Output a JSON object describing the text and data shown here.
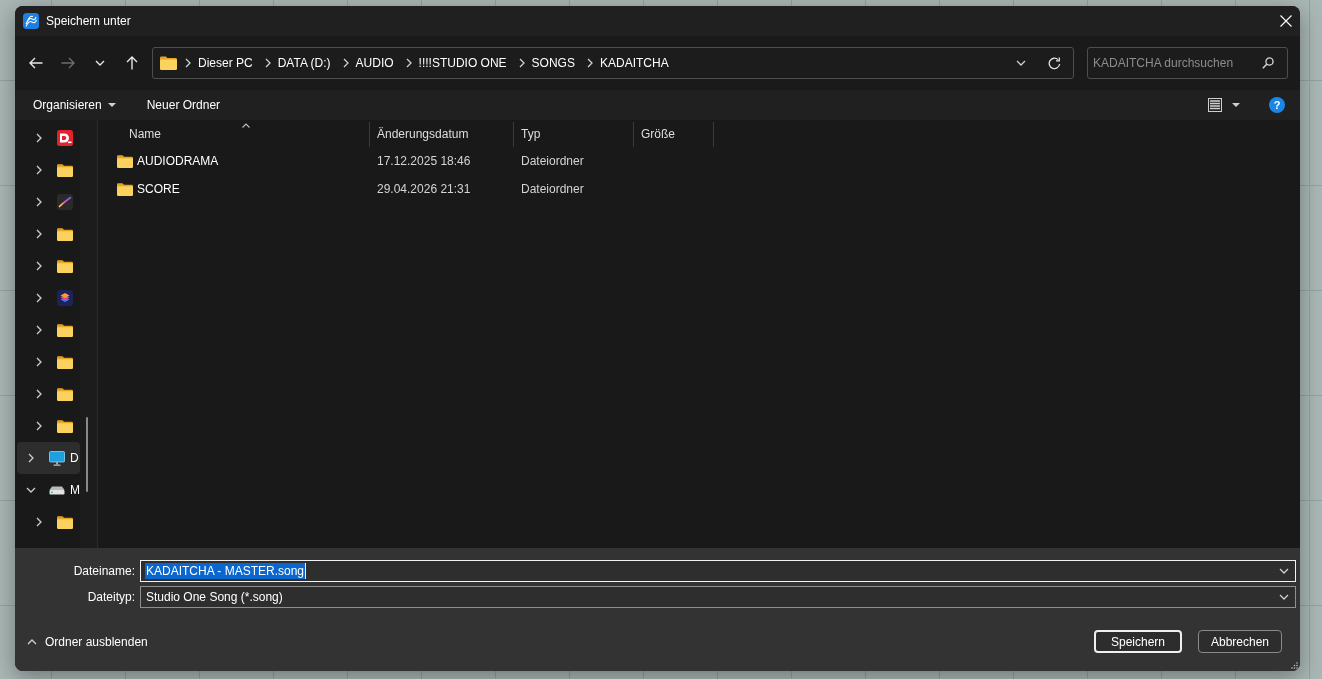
{
  "window": {
    "title": "Speichern unter"
  },
  "navigation": {
    "buttons": [
      {
        "kind": "back",
        "disabled": false
      },
      {
        "kind": "forward",
        "disabled": true
      },
      {
        "kind": "recent",
        "disabled": false
      },
      {
        "kind": "up",
        "disabled": false
      }
    ]
  },
  "address_bar": {
    "path": [
      "Dieser PC",
      "DATA (D:)",
      "AUDIO",
      "!!!!STUDIO ONE",
      "SONGS",
      "KADAITCHA"
    ]
  },
  "search": {
    "placeholder": "KADAITCHA durchsuchen"
  },
  "toolbar": {
    "organize": "Organisieren",
    "new_folder": "Neuer Ordner",
    "help": "?"
  },
  "navigation_pane": {
    "items": [
      {
        "children": [
          {
            "kind": "player-app",
            "selected": false,
            "expanded": false
          },
          {
            "kind": "folder",
            "selected": false,
            "expanded": false
          },
          {
            "kind": "paint-app",
            "selected": false,
            "expanded": false
          },
          {
            "kind": "folder",
            "selected": false,
            "expanded": false
          },
          {
            "kind": "folder",
            "selected": false,
            "expanded": false
          },
          {
            "kind": "design-app",
            "selected": false,
            "expanded": false
          },
          {
            "kind": "folder",
            "selected": false,
            "expanded": false
          },
          {
            "kind": "folder",
            "selected": false,
            "expanded": false
          },
          {
            "kind": "folder",
            "selected": false,
            "expanded": false
          },
          {
            "kind": "folder",
            "selected": false,
            "expanded": false
          }
        ]
      },
      {
        "kind": "computer",
        "label": "D",
        "selected": true,
        "expanded": false
      },
      {
        "kind": "drive",
        "label": "M",
        "selected": false,
        "expanded": true,
        "children": [
          {
            "kind": "folder",
            "selected": false,
            "expanded": false
          }
        ]
      }
    ]
  },
  "file_list": {
    "columns": [
      {
        "label": "Name",
        "sorted": true
      },
      {
        "label": "Änderungsdatum",
        "sorted": false
      },
      {
        "label": "Typ",
        "sorted": false
      },
      {
        "label": "Größe",
        "sorted": false
      }
    ],
    "rows": [
      {
        "name": "AUDIODRAMA",
        "modified": "17.12.2025 18:46",
        "type": "Dateiordner",
        "selected": false
      },
      {
        "name": "SCORE",
        "modified": "29.04.2026 21:31",
        "type": "Dateiordner",
        "selected": false
      }
    ]
  },
  "save_form": {
    "fields": [
      {
        "label": "Dateiname:",
        "value": "KADAITCHA - MASTER.song",
        "focused": true
      },
      {
        "label": "Dateityp:",
        "value": "Studio One Song (*.song)",
        "focused": false
      }
    ],
    "hide_folders": "Ordner ausblenden",
    "buttons": [
      {
        "label": "Speichern",
        "default": true
      },
      {
        "label": "Abbrechen",
        "default": false
      }
    ]
  }
}
